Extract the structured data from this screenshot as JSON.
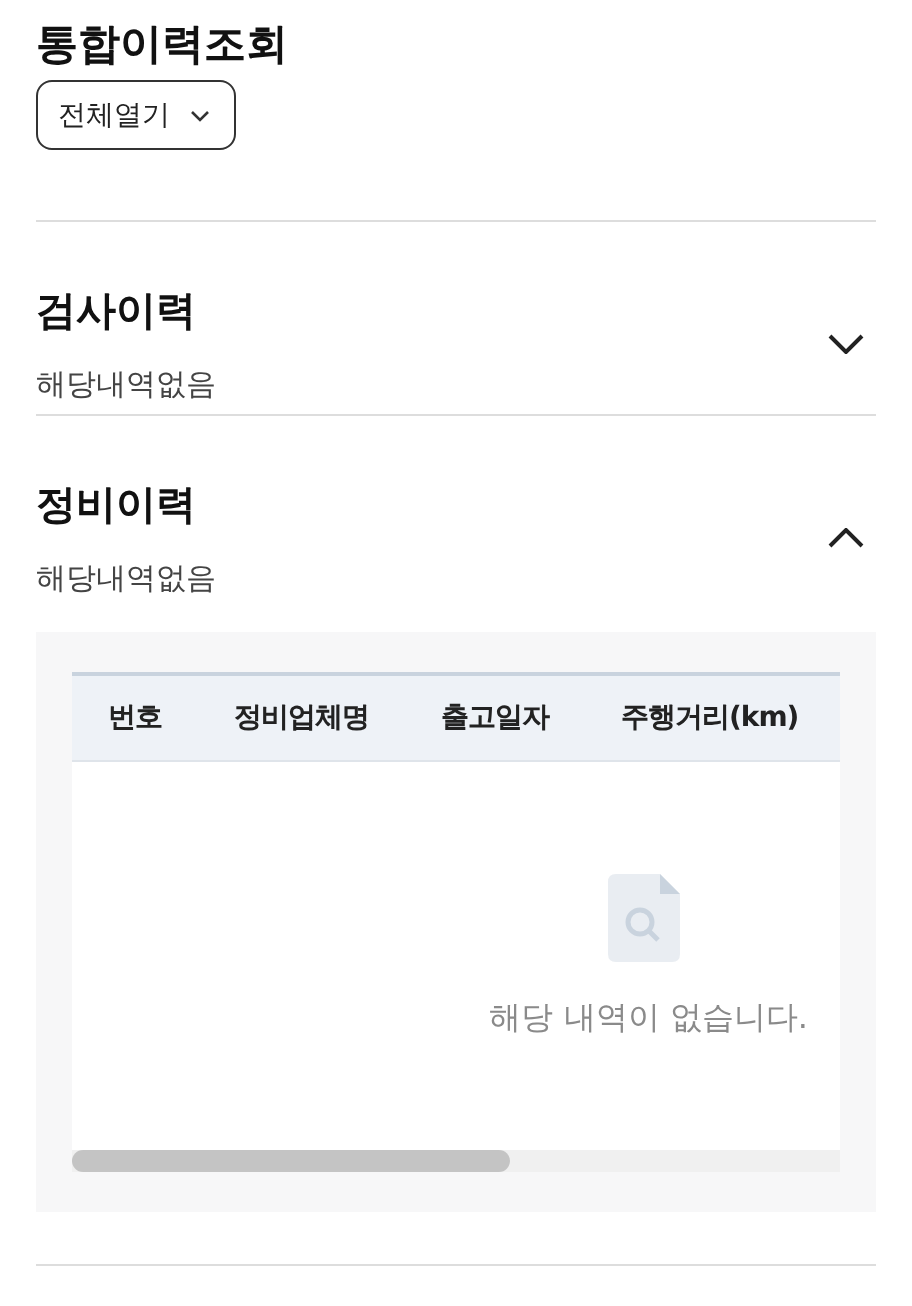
{
  "title": "통합이력조회",
  "expand_all_button": {
    "label": "전체열기"
  },
  "sections": [
    {
      "title": "검사이력",
      "summary": "해당내역없음",
      "expanded": false
    },
    {
      "title": "정비이력",
      "summary": "해당내역없음",
      "expanded": true,
      "table": {
        "columns": [
          "번호",
          "정비업체명",
          "출고일자",
          "주행거리(km)"
        ],
        "empty_message": "해당 내역이 없습니다."
      }
    }
  ]
}
